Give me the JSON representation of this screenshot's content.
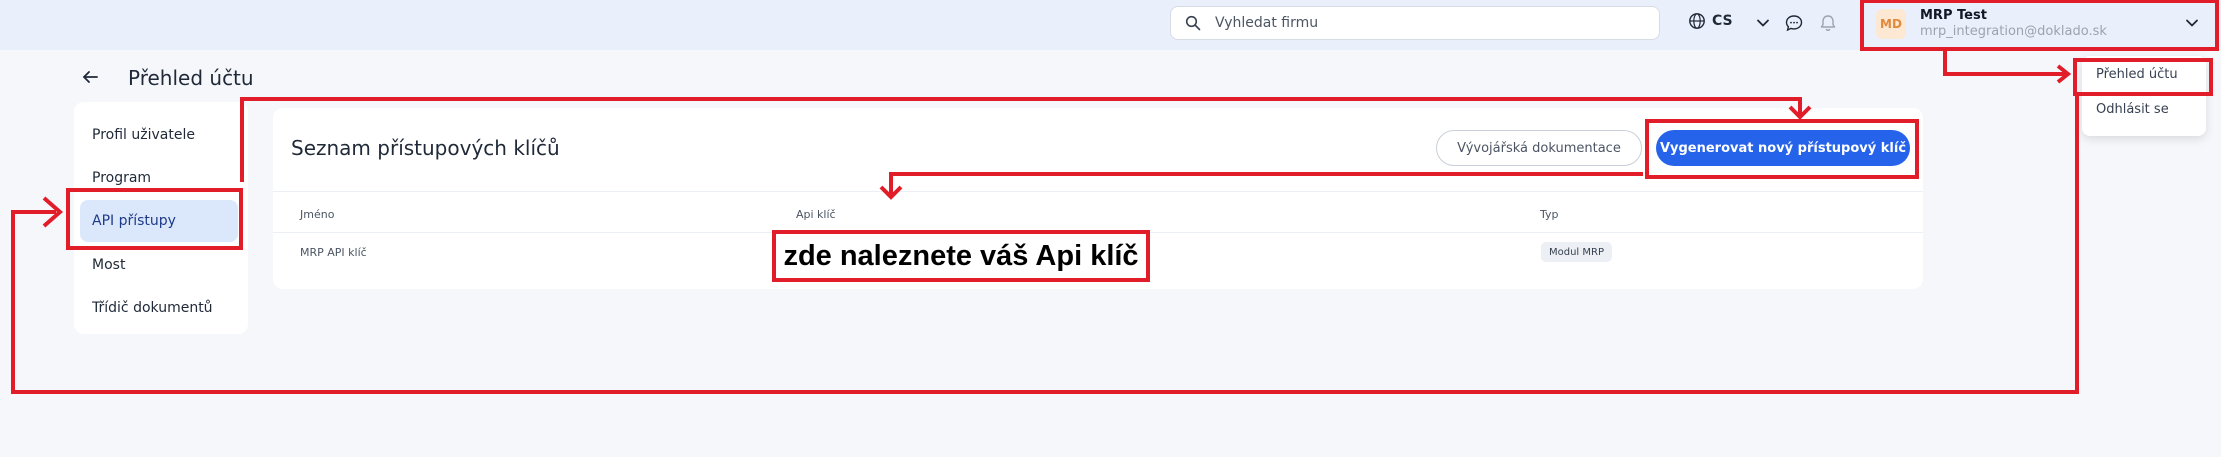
{
  "topbar": {
    "search_placeholder": "Vyhledat firmu",
    "language": "CS",
    "user": {
      "initials": "MD",
      "name": "MRP Test",
      "email": "mrp_integration@doklado.sk"
    }
  },
  "dropdown": {
    "items": [
      "Přehled účtu",
      "Odhlásit se"
    ]
  },
  "page": {
    "title": "Přehled účtu"
  },
  "sidebar": {
    "items": [
      {
        "label": "Profil uživatele"
      },
      {
        "label": "Program"
      },
      {
        "label": "API přístupy",
        "active": true
      },
      {
        "label": "Most"
      },
      {
        "label": "Třídič dokumentů"
      }
    ]
  },
  "card": {
    "title": "Seznam přístupových klíčů",
    "doc_button": "Vývojářská dokumentace",
    "new_key_button": "Vygenerovat nový přístupový klíč",
    "columns": [
      "Jméno",
      "Api klíč",
      "Typ"
    ],
    "rows": [
      {
        "name": "MRP API klíč",
        "api_key": "",
        "type": "Modul MRP"
      }
    ]
  },
  "annotation": {
    "callout_text": "zde naleznete váš Api klíč",
    "color": "#e11d2a"
  },
  "colors": {
    "primary": "#2563eb",
    "active_bg": "#dbe8fb",
    "topbar_bg": "#eaf0fb",
    "page_bg": "#f5f7fb"
  }
}
